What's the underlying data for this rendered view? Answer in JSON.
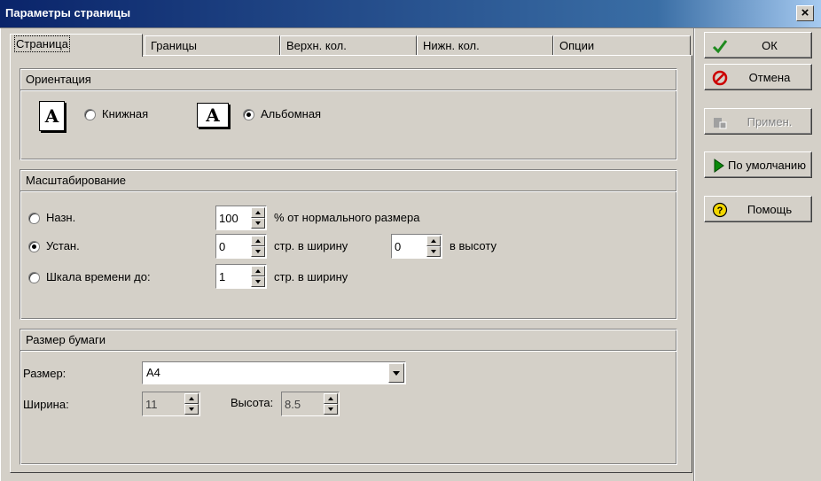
{
  "window": {
    "title": "Параметры страницы",
    "close_label": "×"
  },
  "tabs": [
    {
      "label": "Страница",
      "active": true
    },
    {
      "label": "Границы",
      "active": false
    },
    {
      "label": "Верхн. кол.",
      "active": false
    },
    {
      "label": "Нижн. кол.",
      "active": false
    },
    {
      "label": "Опции",
      "active": false
    }
  ],
  "orientation": {
    "heading": "Ориентация",
    "icon_glyph": "A",
    "portrait_label": "Книжная",
    "landscape_label": "Альбомная",
    "selected": "landscape"
  },
  "scaling": {
    "heading": "Масштабирование",
    "options": [
      {
        "label": "Назн.",
        "selected": false,
        "value": "100",
        "suffix": "% от нормального размера"
      },
      {
        "label": "Устан.",
        "selected": true,
        "value": "0",
        "suffix": "стр. в ширину",
        "value2": "0",
        "suffix2": "в высоту"
      },
      {
        "label": "Шкала времени до:",
        "selected": false,
        "value": "1",
        "suffix": "стр. в ширину"
      }
    ]
  },
  "paper": {
    "heading": "Размер бумаги",
    "size_label": "Размер:",
    "size_value": "A4",
    "width_label": "Ширина:",
    "width_value": "11",
    "height_label": "Высота:",
    "height_value": "8.5"
  },
  "buttons": {
    "ok": "ОК",
    "cancel": "Отмена",
    "apply": "Примен.",
    "defaults": "По умолчанию",
    "help": "Помощь"
  },
  "icons": [
    "check-icon",
    "cancel-icon",
    "apply-icon",
    "play-icon",
    "help-icon"
  ],
  "colors": {
    "title_bar": "#0a246a",
    "ok_check": "#1f8a1f",
    "cancel_red": "#cc0000",
    "play_green": "#0a8a0a",
    "help_yellow": "#f2d600"
  }
}
